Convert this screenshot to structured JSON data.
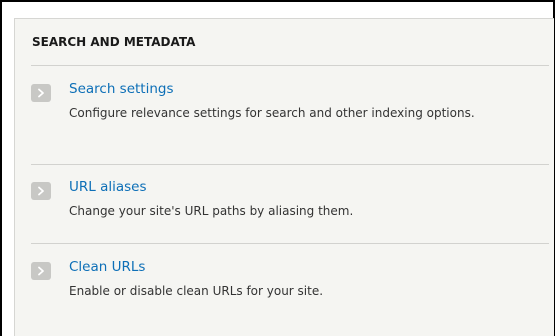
{
  "section": {
    "title": "SEARCH AND METADATA"
  },
  "items": [
    {
      "label": "Search settings",
      "description": "Configure relevance settings for search and other indexing options."
    },
    {
      "label": "URL aliases",
      "description": "Change your site's URL paths by aliasing them."
    },
    {
      "label": "Clean URLs",
      "description": "Enable or disable clean URLs for your site."
    }
  ],
  "colors": {
    "link": "#0d6fb7",
    "panel_background": "#f5f5f2",
    "arrow_box": "#c8c8c5"
  },
  "icons": {
    "item_icon": "chevron-right-icon"
  }
}
